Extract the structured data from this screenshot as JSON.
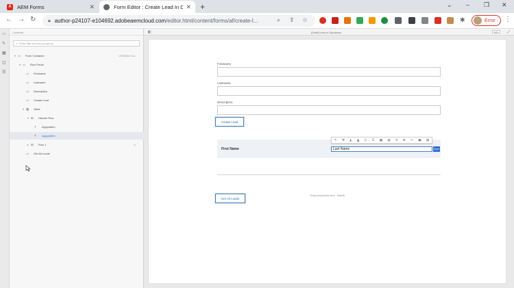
{
  "browser": {
    "tabs": [
      {
        "title": "AEM Forms",
        "favicon": "adobe-icon"
      },
      {
        "title": "Form Editor : Create Lead In Dy",
        "favicon": "globe-icon"
      }
    ],
    "url_host": "author-p24107-e104692.adobeaemcloud.com",
    "url_path": "/editor.html/content/forms/af/create-l...",
    "profile_label": "Error",
    "profile_color": "#d93025"
  },
  "sidebar": {
    "header": "Contents",
    "search_placeholder": "Enter title and form property",
    "tree": [
      {
        "label": "Form Container",
        "right": "VIEWABLE ALL"
      },
      {
        "label": "Root Panel"
      },
      {
        "label": "Firstname"
      },
      {
        "label": "Lastname"
      },
      {
        "label": "Description"
      },
      {
        "label": "Create Lead"
      },
      {
        "label": "Table"
      },
      {
        "label": "Header Row"
      },
      {
        "label": "Apppattern"
      },
      {
        "label": "Apppattern"
      },
      {
        "label": "Row 1"
      },
      {
        "label": "Get All Leads"
      }
    ]
  },
  "canvas": {
    "title": "[Draft] Lead to Dynamics",
    "zoom_label": "Edit",
    "fields": [
      {
        "label": "Firstname"
      },
      {
        "label": "Lastname"
      },
      {
        "label": "Description"
      }
    ],
    "create_button": "Create Lead",
    "table_first_cell": "First Name",
    "inline_edit_value": "Last Name",
    "inline_done": "Done",
    "get_all_button": "Get All Leads",
    "footer": "Drag components here · Submit"
  },
  "colors": {
    "accent": "#2c6fd2",
    "button_border": "#4a7fb5"
  }
}
